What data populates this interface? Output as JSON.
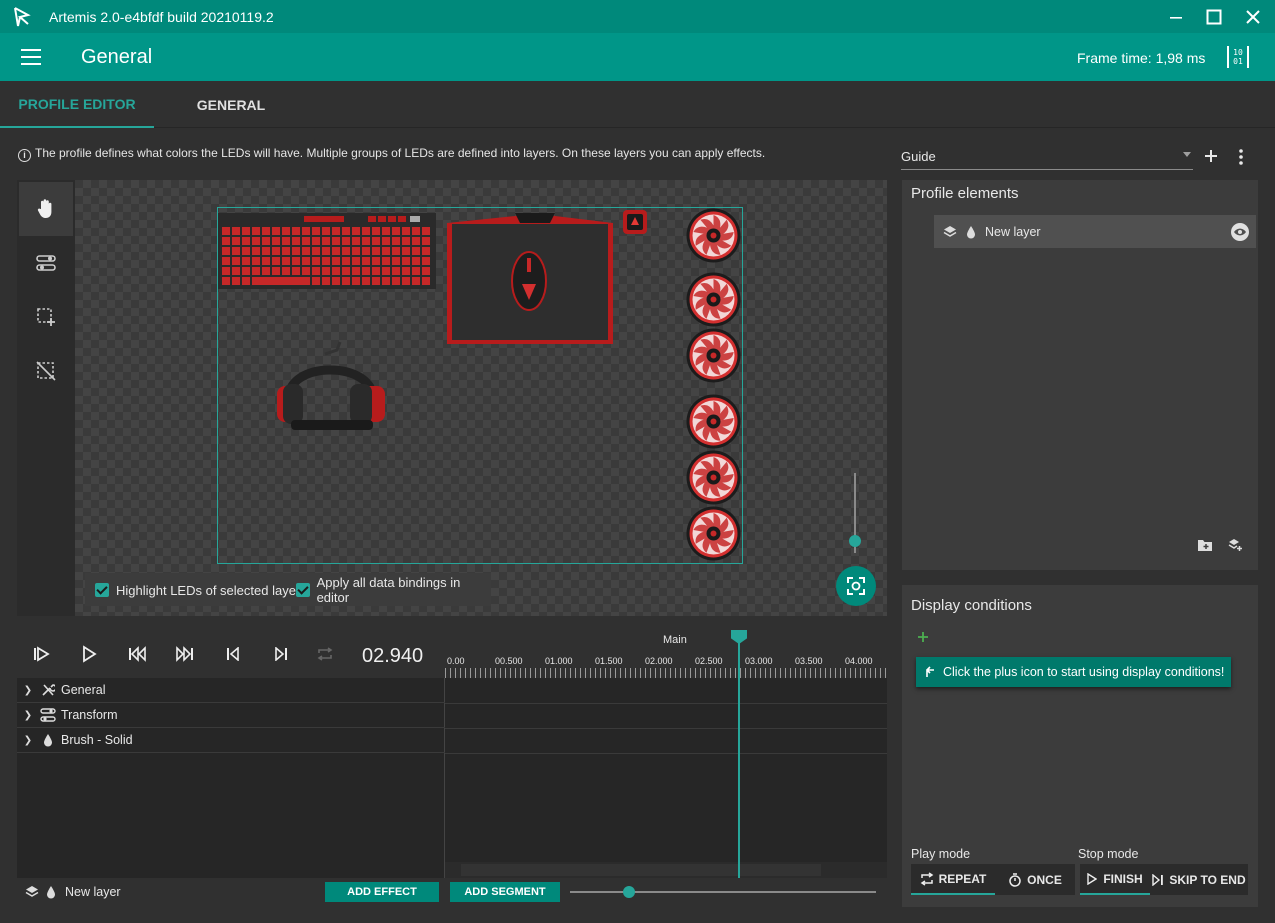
{
  "window": {
    "title": "Artemis 2.0-e4bfdf build 20210119.2",
    "controls": [
      "minimize-icon",
      "maximize-icon",
      "close-icon"
    ]
  },
  "header": {
    "title": "General",
    "frame_time": "Frame time: 1,98 ms",
    "debug_glyph": "[10 01]"
  },
  "tabs": [
    {
      "label": "PROFILE EDITOR",
      "active": true
    },
    {
      "label": "GENERAL",
      "active": false
    }
  ],
  "info_text": "The profile defines what colors the LEDs will have. Multiple groups of LEDs are defined into layers. On these layers you can apply effects.",
  "guide_select": {
    "value": "Guide"
  },
  "editor": {
    "tools": [
      "hand-icon",
      "selection-tune-icon",
      "select-add-icon",
      "select-remove-icon"
    ],
    "checkboxes": [
      {
        "label": "Highlight LEDs of selected layer",
        "checked": true
      },
      {
        "label": "Apply all data bindings in editor",
        "checked": true
      }
    ],
    "devices": [
      "keyboard",
      "mousepad",
      "mouse",
      "headset",
      "fan",
      "fan",
      "fan",
      "fan",
      "fan",
      "fan",
      "headset-stand"
    ]
  },
  "timeline": {
    "time": "02.940",
    "segment_label": "Main",
    "ruler_labels": [
      "0.00",
      "00.500",
      "01.000",
      "01.500",
      "02.000",
      "02.500",
      "03.000",
      "03.500",
      "04.000"
    ],
    "properties": [
      {
        "label": "General",
        "icon": "tools-icon"
      },
      {
        "label": "Transform",
        "icon": "transform-icon"
      },
      {
        "label": "Brush - Solid",
        "icon": "droplet-icon"
      }
    ],
    "playhead_seconds": 2.94
  },
  "bottom_bar": {
    "layer_name": "New layer",
    "add_effect": "ADD EFFECT",
    "add_segment": "ADD SEGMENT",
    "zoom_level": 0.18
  },
  "profile_elements": {
    "title": "Profile elements",
    "layer": "New layer"
  },
  "display_conditions": {
    "title": "Display conditions",
    "hint": "Click the plus icon to start using display conditions!",
    "play_mode_label": "Play mode",
    "stop_mode_label": "Stop mode",
    "play_modes": [
      {
        "label": "REPEAT",
        "active": true
      },
      {
        "label": "ONCE",
        "active": false
      }
    ],
    "stop_modes": [
      {
        "label": "FINISH",
        "active": true
      },
      {
        "label": "SKIP TO END",
        "active": false
      }
    ]
  },
  "colors": {
    "accent": "#009688",
    "accent_dark": "#00897b",
    "teal_line": "#26a69a",
    "background": "#303030"
  }
}
